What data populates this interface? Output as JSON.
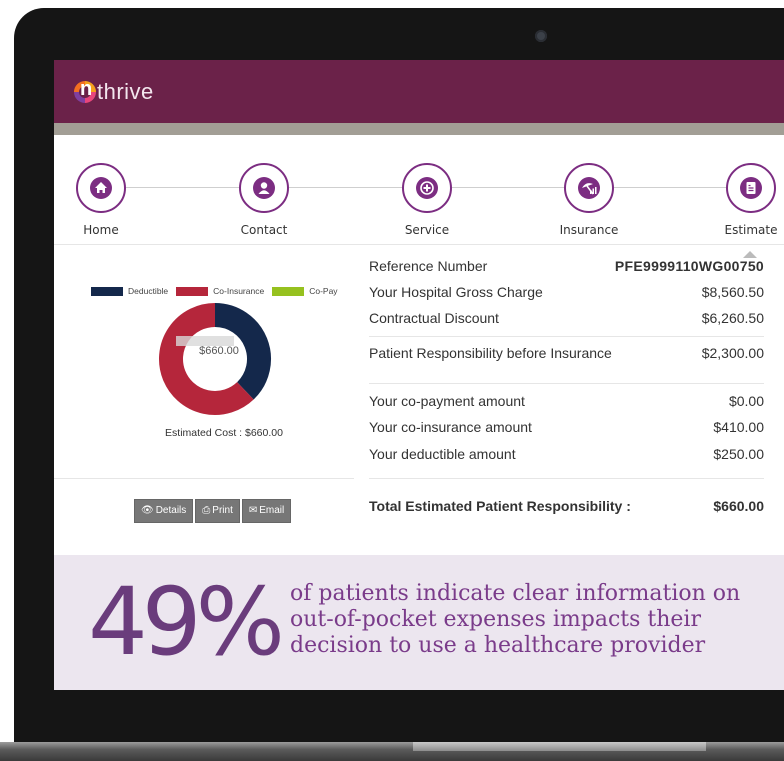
{
  "brand": {
    "logo_n": "n",
    "logo_text": "thrive"
  },
  "steps": [
    {
      "label": "Home",
      "icon": "home-icon"
    },
    {
      "label": "Contact",
      "icon": "person-icon"
    },
    {
      "label": "Service",
      "icon": "medical-cross-icon"
    },
    {
      "label": "Insurance",
      "icon": "umbrella-icon"
    },
    {
      "label": "Estimate",
      "icon": "document-icon"
    }
  ],
  "chart": {
    "center_label": "$660.00",
    "estimated_cost": "Estimated Cost : $660.00",
    "legend": [
      "Deductible",
      "Co-Insurance",
      "Co-Pay"
    ]
  },
  "chart_data": {
    "type": "pie",
    "categories": [
      "Deductible",
      "Co-Insurance",
      "Co-Pay"
    ],
    "values": [
      250,
      410,
      0
    ],
    "colors": [
      "#14284b",
      "#b5263b",
      "#96c11f"
    ]
  },
  "buttons": {
    "details": "Details",
    "print": "Print",
    "email": "Email"
  },
  "estimate": {
    "reference": {
      "label": "Reference Number",
      "value": "PFE9999110WG00750"
    },
    "gross": {
      "label": "Your Hospital Gross Charge",
      "value": "$8,560.50"
    },
    "discount": {
      "label": "Contractual Discount",
      "value": "$6,260.50"
    },
    "responsibility": {
      "label": "Patient Responsibility before Insurance",
      "value": "$2,300.00"
    },
    "copay": {
      "label": "Your co-payment amount",
      "value": "$0.00"
    },
    "coins": {
      "label": "Your co-insurance amount",
      "value": "$410.00"
    },
    "deductible": {
      "label": "Your deductible amount",
      "value": "$250.00"
    },
    "total": {
      "label": "Total Estimated Patient Responsibility :",
      "value": "$660.00"
    }
  },
  "banner": {
    "stat": "49%",
    "text": "of patients indicate clear information on out-of-pocket expenses impacts their decision to use a healthcare provider"
  }
}
